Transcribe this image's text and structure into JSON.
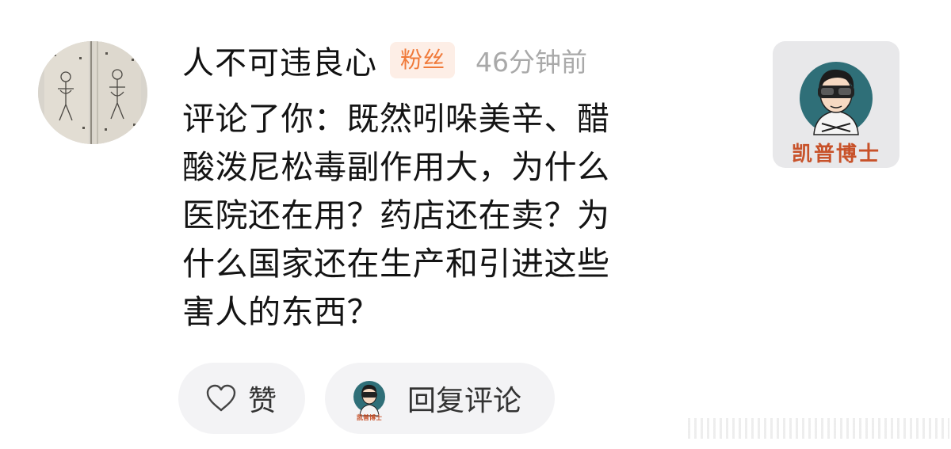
{
  "comment_item": {
    "username": "人不可违良心",
    "badge": "粉丝",
    "time": "46分钟前",
    "content": "评论了你：既然吲哚美辛、醋\n酸泼尼松毒副作用大，为什么\n医院还在用？药店还在卖？为\n什么国家还在生产和引进这些\n害人的东西？"
  },
  "post_thumbnail": {
    "logo_text": "凯普博士"
  },
  "actions": {
    "like_label": "赞",
    "reply_label": "回复评论"
  },
  "icons": {
    "like": "heart-outline-icon",
    "reply_avatar": "avatar-icon"
  },
  "colors": {
    "badge_bg": "#fdeee6",
    "badge_text": "#f07a3a",
    "time_text": "#a9a9a9",
    "button_bg": "#f3f3f5",
    "logo_circle": "#2f6f78",
    "logo_text": "#c8522a"
  }
}
